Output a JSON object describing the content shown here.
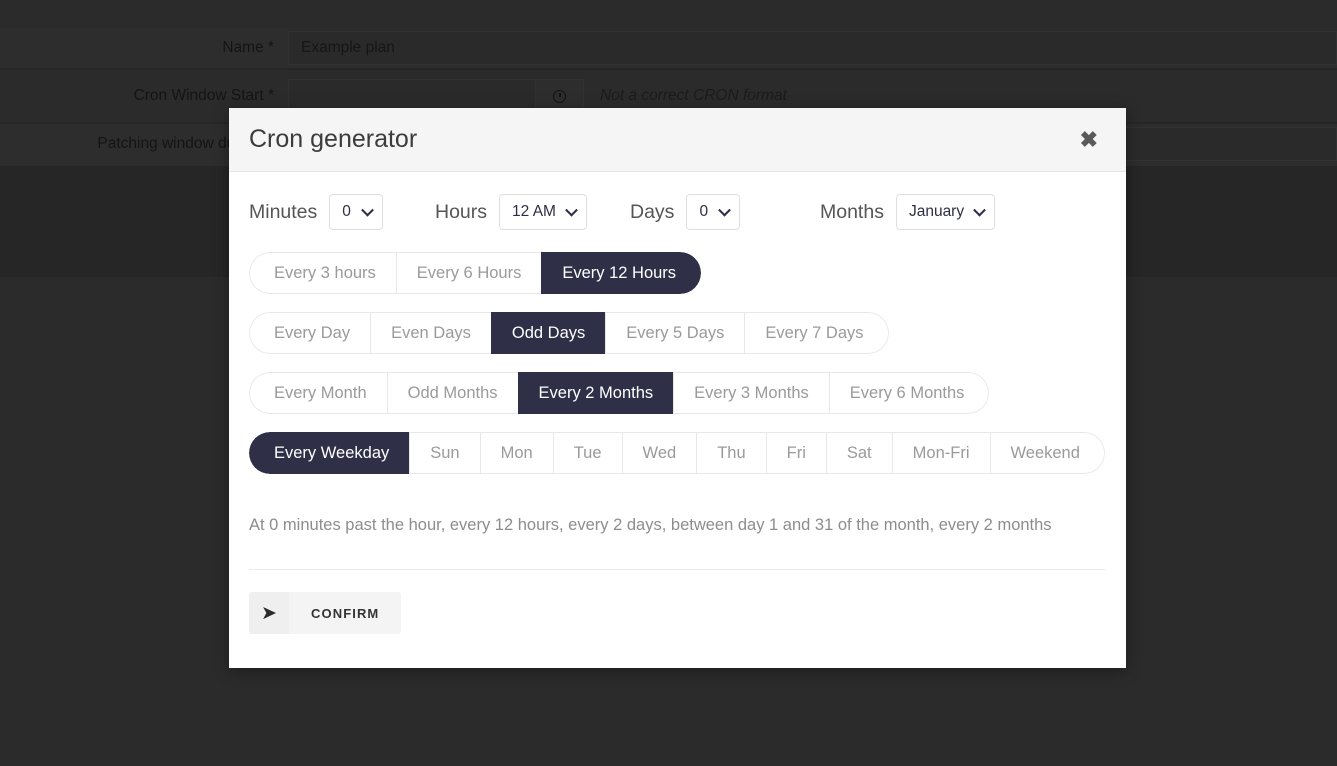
{
  "background_form": {
    "fields": [
      {
        "label": "Name *",
        "value": "Example plan"
      },
      {
        "label": "Cron Window Start *",
        "value": ""
      },
      {
        "label": "Patching window duration",
        "value": ""
      }
    ],
    "cron_error": "Not a correct CRON format",
    "clock_icon": "clock-icon"
  },
  "modal": {
    "title": "Cron generator",
    "close_icon": "✖",
    "selects": [
      {
        "label": "Minutes",
        "value": "0"
      },
      {
        "label": "Hours",
        "value": "12 AM"
      },
      {
        "label": "Days",
        "value": "0"
      },
      {
        "label": "Months",
        "value": "January"
      }
    ],
    "hour_presets": [
      {
        "label": "Every 3 hours",
        "active": false
      },
      {
        "label": "Every 6 Hours",
        "active": false
      },
      {
        "label": "Every 12 Hours",
        "active": true
      }
    ],
    "day_presets": [
      {
        "label": "Every Day",
        "active": false
      },
      {
        "label": "Even Days",
        "active": false
      },
      {
        "label": "Odd Days",
        "active": true
      },
      {
        "label": "Every 5 Days",
        "active": false
      },
      {
        "label": "Every 7 Days",
        "active": false
      }
    ],
    "month_presets": [
      {
        "label": "Every Month",
        "active": false
      },
      {
        "label": "Odd Months",
        "active": false
      },
      {
        "label": "Every 2 Months",
        "active": true
      },
      {
        "label": "Every 3 Months",
        "active": false
      },
      {
        "label": "Every 6 Months",
        "active": false
      }
    ],
    "weekday_presets": [
      {
        "label": "Every Weekday",
        "active": true
      },
      {
        "label": "Sun",
        "active": false
      },
      {
        "label": "Mon",
        "active": false
      },
      {
        "label": "Tue",
        "active": false
      },
      {
        "label": "Wed",
        "active": false
      },
      {
        "label": "Thu",
        "active": false
      },
      {
        "label": "Fri",
        "active": false
      },
      {
        "label": "Sat",
        "active": false
      },
      {
        "label": "Mon-Fri",
        "active": false
      },
      {
        "label": "Weekend",
        "active": false
      }
    ],
    "description": "At 0 minutes past the hour, every 12 hours, every 2 days, between day 1 and 31 of the month, every 2 months",
    "confirm": {
      "label": "CONFIRM",
      "icon": "➤",
      "icon_name": "send-icon"
    }
  },
  "colors": {
    "active": "#2f2f48",
    "overlay": "#262626",
    "header_bg": "#f5f5f5"
  }
}
